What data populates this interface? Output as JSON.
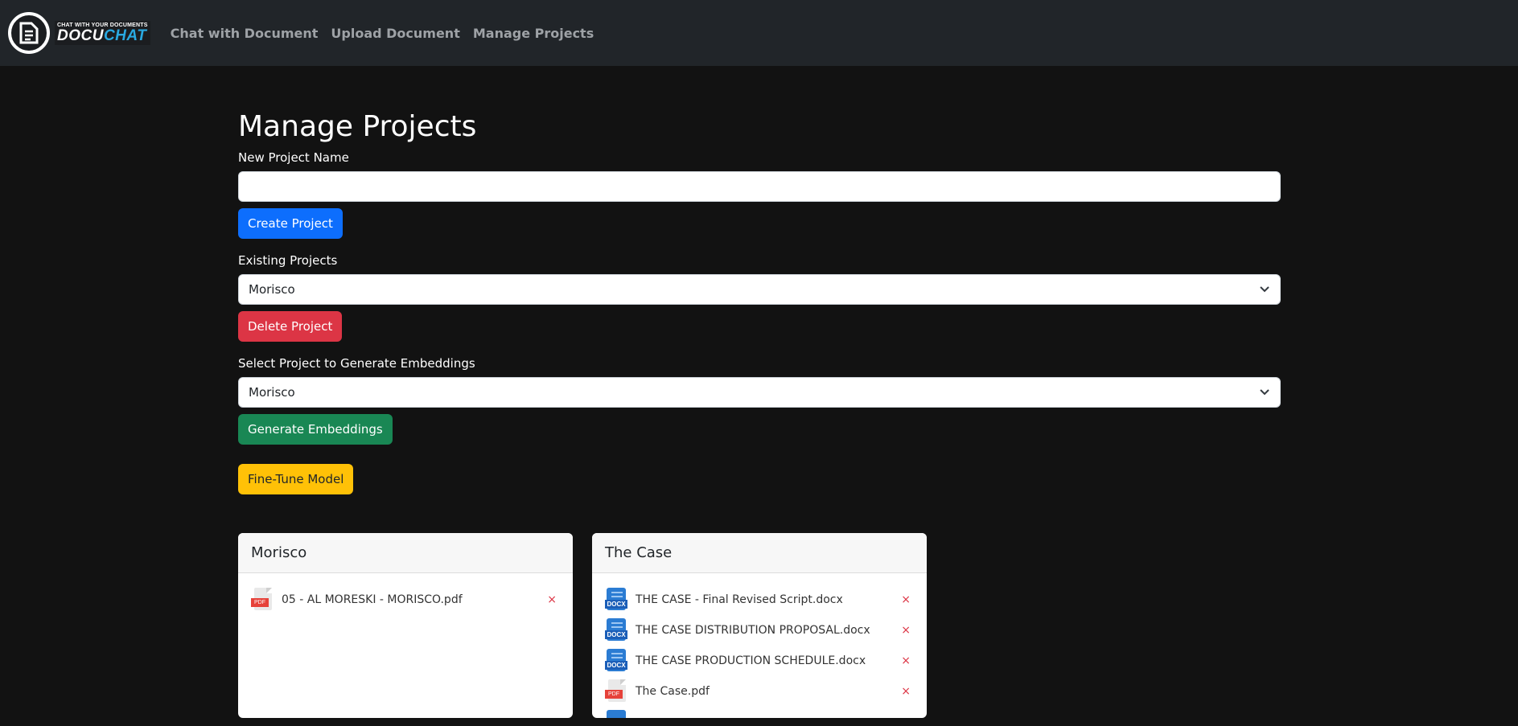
{
  "nav": {
    "brand_tagline": "CHAT WITH YOUR DOCUMENTS",
    "brand_name_part1": "DOCU",
    "brand_name_part2": "CHAT",
    "links": [
      "Chat with Document",
      "Upload Document",
      "Manage Projects"
    ]
  },
  "page": {
    "title": "Manage Projects",
    "new_project_label": "New Project Name",
    "new_project_value": "",
    "create_button": "Create Project",
    "existing_label": "Existing Projects",
    "existing_selected": "Morisco",
    "delete_button": "Delete Project",
    "embed_label": "Select Project to Generate Embeddings",
    "embed_selected": "Morisco",
    "generate_button": "Generate Embeddings",
    "finetune_button": "Fine-Tune Model"
  },
  "projects": [
    {
      "name": "Morisco",
      "files": [
        {
          "name": "05 - AL MORESKI - MORISCO.pdf",
          "type": "pdf"
        }
      ]
    },
    {
      "name": "The Case",
      "files": [
        {
          "name": "THE CASE - Final Revised Script.docx",
          "type": "docx"
        },
        {
          "name": "THE CASE DISTRIBUTION PROPOSAL.docx",
          "type": "docx"
        },
        {
          "name": "THE CASE PRODUCTION SCHEDULE.docx",
          "type": "docx"
        },
        {
          "name": "The Case.pdf",
          "type": "pdf"
        }
      ]
    }
  ],
  "icons": {
    "remove": "×",
    "pdf_tag": "PDF",
    "docx_tag": "DOCX"
  },
  "colors": {
    "primary": "#0d6efd",
    "danger": "#dc3545",
    "success": "#198754",
    "warning": "#ffc107",
    "brand_accent": "#29a9e1"
  }
}
